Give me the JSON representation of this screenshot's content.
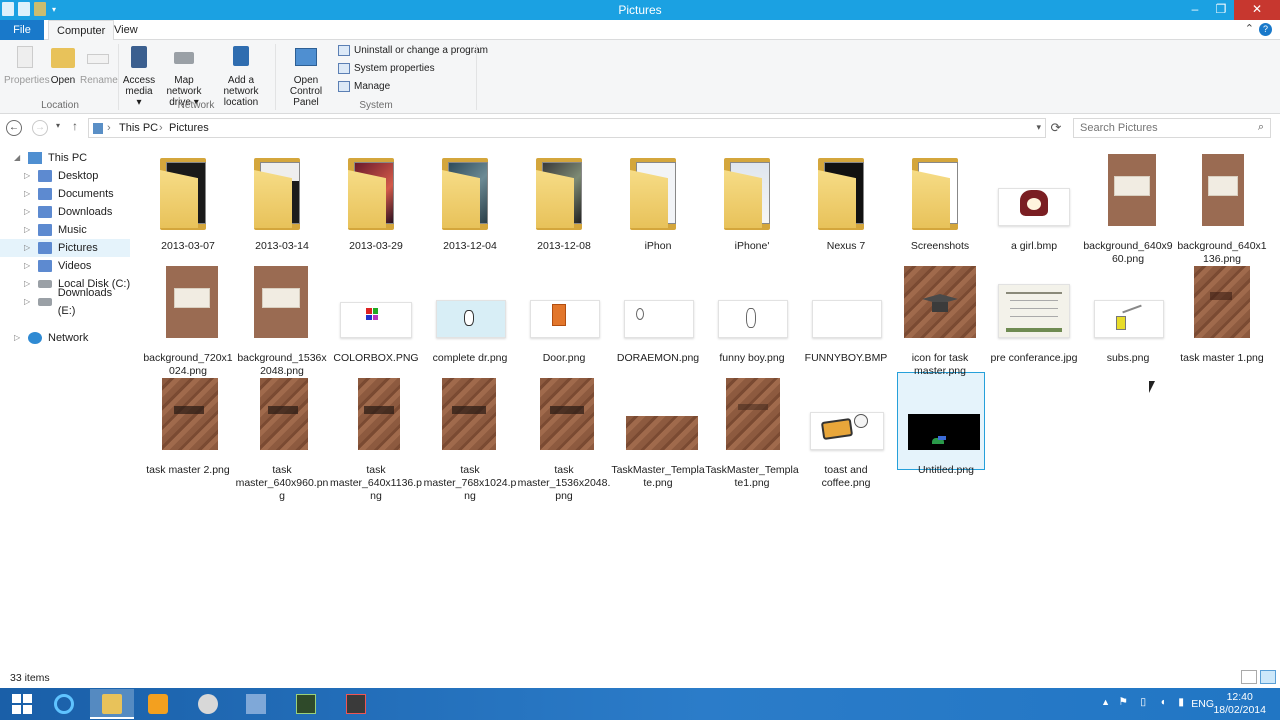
{
  "window": {
    "title": "Pictures"
  },
  "tabs": {
    "file": "File",
    "computer": "Computer",
    "view": "View"
  },
  "ribbon": {
    "location": {
      "properties": "Properties",
      "open": "Open",
      "rename": "Rename",
      "group": "Location"
    },
    "network": {
      "access_media": "Access media",
      "map_drive": "Map network drive",
      "add_location": "Add a network location",
      "group": "Network"
    },
    "system": {
      "open_cp": "Open Control Panel",
      "uninstall": "Uninstall or change a program",
      "sysprops": "System properties",
      "manage": "Manage",
      "group": "System"
    }
  },
  "address": {
    "crumb1": "This PC",
    "crumb2": "Pictures",
    "search_placeholder": "Search Pictures"
  },
  "nav": {
    "this_pc": "This PC",
    "desktop": "Desktop",
    "documents": "Documents",
    "downloads": "Downloads",
    "music": "Music",
    "pictures": "Pictures",
    "videos": "Videos",
    "local_disk": "Local Disk (C:)",
    "downloads_e": "Downloads (E:)",
    "network": "Network"
  },
  "items": [
    "2013-03-07",
    "2013-03-14",
    "2013-03-29",
    "2013-12-04",
    "2013-12-08",
    "iPhon",
    "iPhone'",
    "Nexus 7",
    "Screenshots",
    "a girl.bmp",
    "background_640x960.png",
    "background_640x1136.png",
    "background_720x1024.png",
    "background_1536x2048.png",
    "COLORBOX.PNG",
    "complete dr.png",
    "Door.png",
    "DORAEMON.png",
    "funny boy.png",
    "FUNNYBOY.BMP",
    "icon for task master.png",
    "pre conferance.jpg",
    "subs.png",
    "task master 1.png",
    "task master 2.png",
    "task master_640x960.png",
    "task master_640x1136.png",
    "task master_768x1024.png",
    "task master_1536x2048.png",
    "TaskMaster_Template.png",
    "TaskMaster_Template1.png",
    "toast and coffee.png",
    "Untitled.png"
  ],
  "status": {
    "count": "33 items"
  },
  "tray": {
    "lang": "ENG",
    "time": "12:40",
    "date": "18/02/2014"
  },
  "colors": {
    "titlebar": "#1ba1e2",
    "file_tab": "#1979ca",
    "taskbar": "#2176c4",
    "selection": "#26a0da"
  }
}
